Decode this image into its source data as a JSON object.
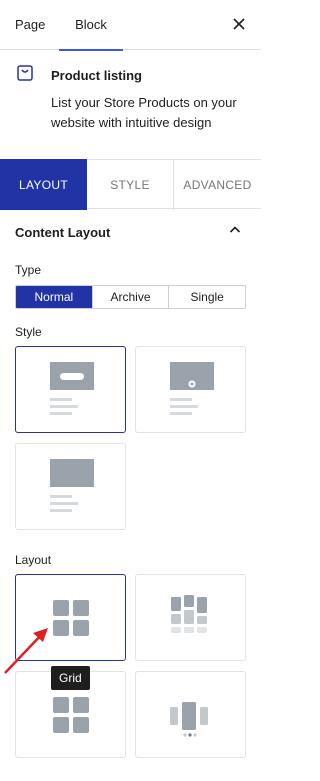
{
  "header": {
    "tabs": [
      {
        "label": "Page"
      },
      {
        "label": "Block"
      }
    ],
    "close_icon": "close-icon"
  },
  "block": {
    "icon": "product-listing-icon",
    "title": "Product listing",
    "description": "List your Store Products on your website with intuitive design"
  },
  "panel_tabs": [
    {
      "label": "LAYOUT",
      "active": true
    },
    {
      "label": "STYLE",
      "active": false
    },
    {
      "label": "ADVANCED",
      "active": false
    }
  ],
  "content_layout": {
    "title": "Content Layout",
    "collapse_icon": "chevron-up-icon",
    "type": {
      "label": "Type",
      "options": [
        "Normal",
        "Archive",
        "Single"
      ],
      "selected": "Normal"
    },
    "style": {
      "label": "Style",
      "options": [
        "style-1",
        "style-2",
        "style-3"
      ],
      "selected": "style-1"
    },
    "layout": {
      "label": "Layout",
      "options": [
        "grid",
        "masonry",
        "list",
        "carousel"
      ],
      "selected": "grid",
      "tooltip": "Grid"
    }
  },
  "colors": {
    "accent": "#2233a5",
    "tab_underline": "#3858e9",
    "placeholder_gray": "#9aa3ac",
    "annotation_arrow": "#e02020"
  }
}
